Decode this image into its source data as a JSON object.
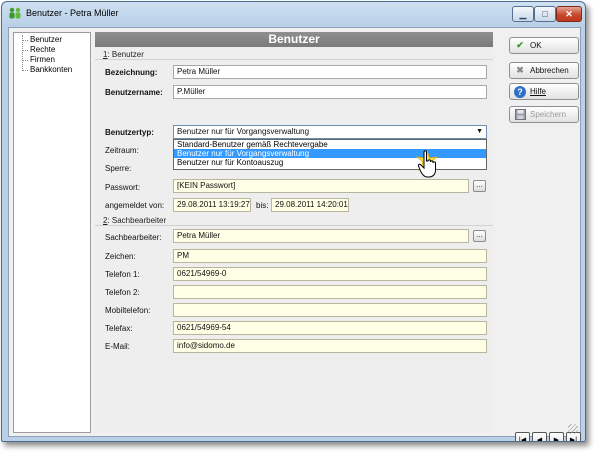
{
  "window": {
    "title": "Benutzer - Petra Müller",
    "icon": "app-users-icon"
  },
  "tree": {
    "items": [
      "Benutzer",
      "Rechte",
      "Firmen",
      "Bankkonten"
    ]
  },
  "panel": {
    "header": "Benutzer",
    "group1": {
      "number": "1",
      "title": ": Benutzer"
    },
    "bezeichnung": {
      "label": "Bezeichnung:",
      "value": "Petra Müller"
    },
    "benutzername": {
      "label": "Benutzername:",
      "value": "P.Müller"
    },
    "benutzertyp": {
      "label": "Benutzertyp:",
      "value": "Benutzer nur für Vorgangsverwaltung",
      "options": [
        "Standard-Benutzer gemäß Rechtevergabe",
        "Benutzer nur für Vorgangsverwaltung",
        "Benutzer nur für Kontoauszug"
      ],
      "selected_index": 1
    },
    "zeitraum": {
      "label": "Zeitraum:"
    },
    "sperre": {
      "label": "Sperre:"
    },
    "passwort": {
      "label": "Passwort:",
      "value": "[KEIN Passwort]"
    },
    "angemeldet": {
      "label": "angemeldet von:",
      "from": "29.08.2011 13:19:27",
      "bis_label": "bis:",
      "to": "29.08.2011 14:20:01"
    },
    "group2": {
      "number": "2",
      "title": ": Sachbearbeiter"
    },
    "sachbearbeiter": {
      "label": "Sachbearbeiter:",
      "value": "Petra Müller"
    },
    "zeichen": {
      "label": "Zeichen:",
      "value": "PM"
    },
    "telefon1": {
      "label": "Telefon 1:",
      "value": "0621/54969-0"
    },
    "telefon2": {
      "label": "Telefon 2:",
      "value": ""
    },
    "mobiltelefon": {
      "label": "Mobiltelefon:",
      "value": ""
    },
    "telefax": {
      "label": "Telefax:",
      "value": "0621/54969-54"
    },
    "email": {
      "label": "E-Mail:",
      "value": "info@sidomo.de"
    }
  },
  "buttons": {
    "ok": "OK",
    "abbrechen": "Abbrechen",
    "hilfe": "Hilfe",
    "speichern": "Speichern",
    "ellipsis": "..."
  },
  "nav": {
    "first": "first-record-icon",
    "prev": "previous-record-icon",
    "next": "next-record-icon",
    "last": "last-record-icon"
  },
  "colors": {
    "field_bg": "#ffffe6",
    "selection": "#3399ff",
    "header_band": "#808080"
  }
}
